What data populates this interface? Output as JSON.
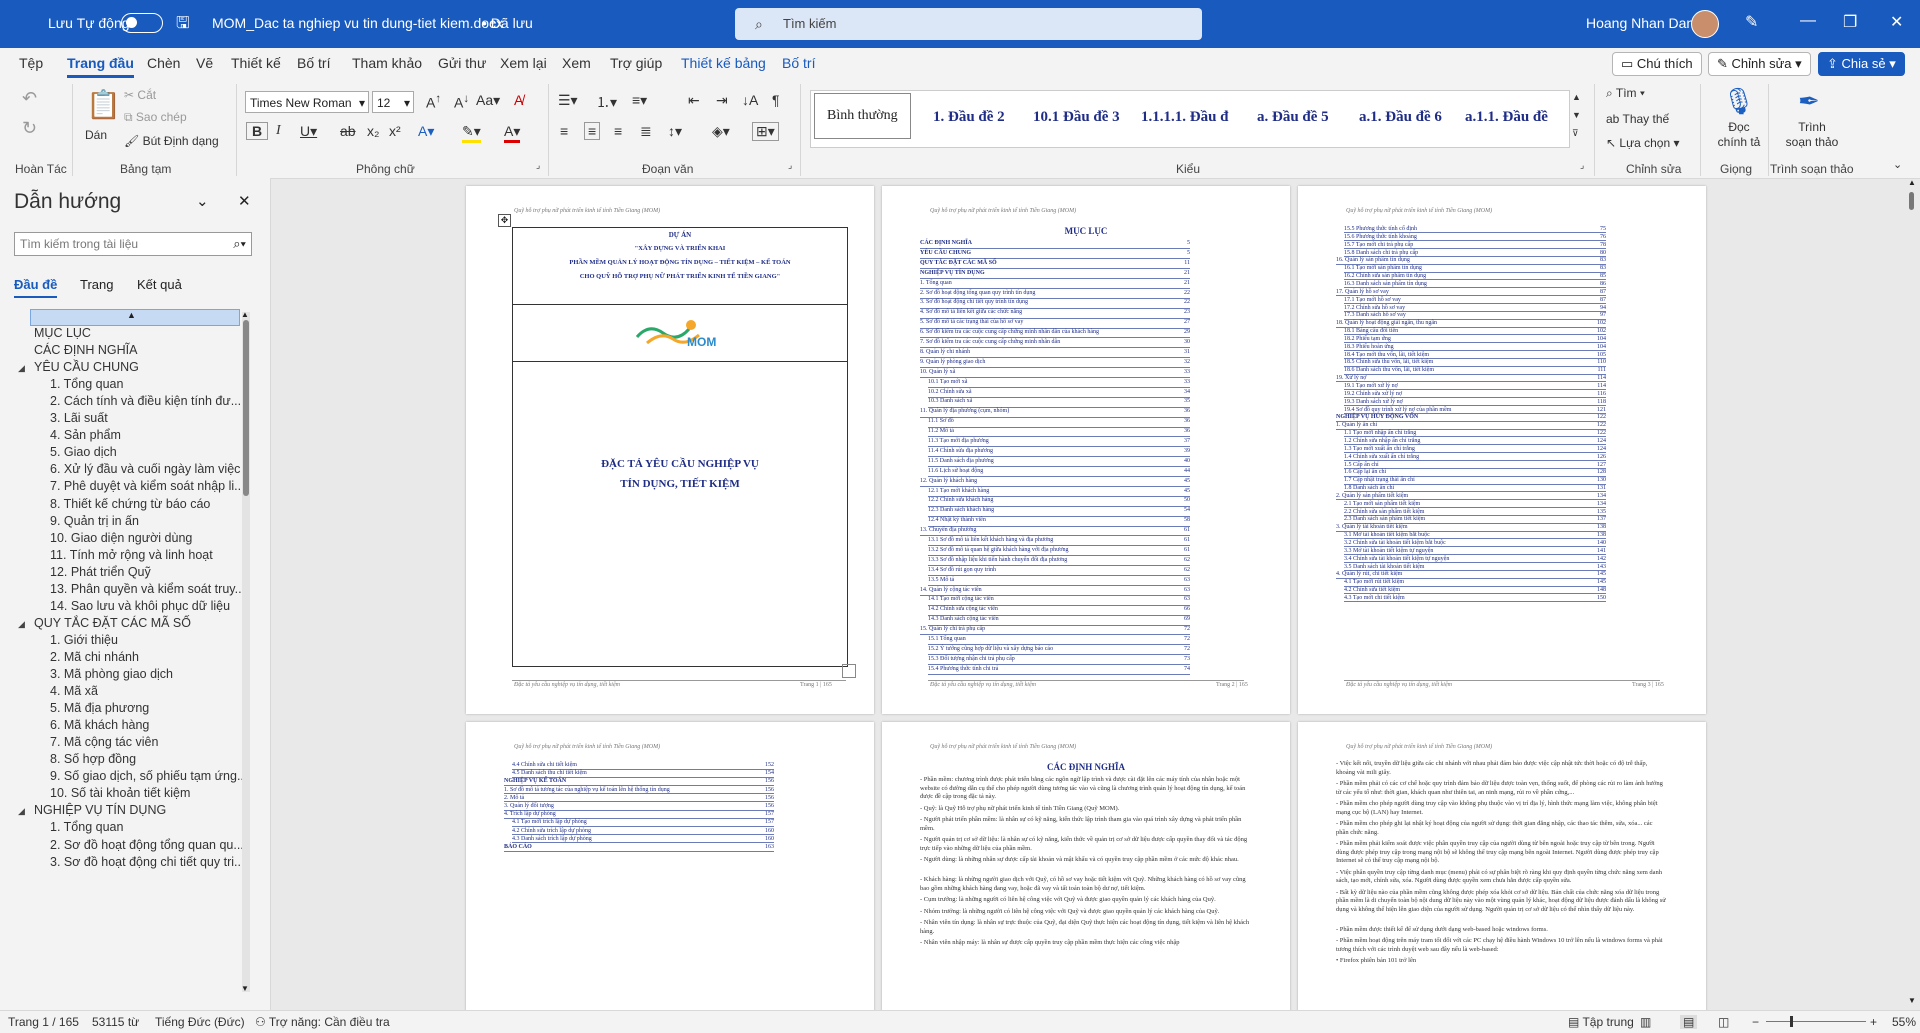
{
  "titlebar": {
    "autosave_label": "Lưu Tự động",
    "doc_title": "MOM_Dac ta nghiep vu tin dung-tiet kiem.docx",
    "saved_status": "• Đã lưu",
    "search_placeholder": "Tìm kiếm",
    "user_name": "Hoang Nhan Dang"
  },
  "tabs": [
    "Tệp",
    "Trang đầu",
    "Chèn",
    "Vẽ",
    "Thiết kế",
    "Bố trí",
    "Tham khảo",
    "Gửi thư",
    "Xem lại",
    "Xem",
    "Trợ giúp",
    "Thiết kế bảng",
    "Bố trí"
  ],
  "tab_buttons": {
    "comments": "Chú thích",
    "editing": "Chỉnh sửa",
    "share": "Chia sẻ"
  },
  "ribbon": {
    "undo_group": "Hoàn Tác",
    "clipboard": {
      "paste": "Dán",
      "cut": "Cắt",
      "copy": "Sao chép",
      "format_painter": "Bút Định dạng",
      "group": "Bảng tạm"
    },
    "font": {
      "name": "Times New Roman",
      "size": "12",
      "group": "Phông chữ"
    },
    "paragraph_group": "Đoạn văn",
    "styles": [
      "Bình thường",
      "1.  Đầu đề 2",
      "10.1  Đầu đề 3",
      "1.1.1.1.  Đầu đ",
      "a.  Đầu đề 5",
      "a.1.  Đầu đề 6",
      "a.1.1.  Đầu đề"
    ],
    "styles_group": "Kiểu",
    "editing": {
      "find": "Tìm",
      "replace": "Thay thế",
      "select": "Lựa chọn",
      "group": "Chỉnh sửa"
    },
    "voice": {
      "dictate": "Đọc chính tả",
      "group": "Giọng"
    },
    "editor": {
      "label": "Trình soạn thảo",
      "group": "Trình soạn thảo"
    }
  },
  "nav": {
    "title": "Dẫn hướng",
    "search_placeholder": "Tìm kiếm trong tài liệu",
    "tabs": [
      "Đầu đề",
      "Trang",
      "Kết quả"
    ],
    "items": [
      {
        "text": "MỤC LỤC",
        "level": 0
      },
      {
        "text": "CÁC ĐỊNH NGHĨA",
        "level": 0
      },
      {
        "text": "YÊU CẦU CHUNG",
        "level": 0,
        "expanded": true
      },
      {
        "text": "1. Tổng quan",
        "level": 1
      },
      {
        "text": "2. Cách tính và điều kiện tính đư...",
        "level": 1
      },
      {
        "text": "3. Lãi suất",
        "level": 1
      },
      {
        "text": "4. Sản phẩm",
        "level": 1
      },
      {
        "text": "5. Giao dịch",
        "level": 1
      },
      {
        "text": "6. Xử lý đầu và cuối ngày làm việc",
        "level": 1
      },
      {
        "text": "7. Phê duyệt và kiểm soát nhập li...",
        "level": 1
      },
      {
        "text": "8. Thiết kế chứng từ báo cáo",
        "level": 1
      },
      {
        "text": "9. Quản trị in ấn",
        "level": 1
      },
      {
        "text": "10. Giao diện người dùng",
        "level": 1
      },
      {
        "text": "11. Tính mở rộng và linh hoạt",
        "level": 1
      },
      {
        "text": "12. Phát triển Quỹ",
        "level": 1
      },
      {
        "text": "13. Phân quyền và kiểm soát truy...",
        "level": 1
      },
      {
        "text": "14. Sao lưu và khôi phục dữ liệu",
        "level": 1
      },
      {
        "text": "QUY TẮC ĐẶT CÁC MÃ SỐ",
        "level": 0,
        "expanded": true
      },
      {
        "text": "1. Giới thiệu",
        "level": 1
      },
      {
        "text": "2. Mã chi nhánh",
        "level": 1
      },
      {
        "text": "3. Mã phòng giao dịch",
        "level": 1
      },
      {
        "text": "4. Mã xã",
        "level": 1
      },
      {
        "text": "5. Mã địa phương",
        "level": 1
      },
      {
        "text": "6. Mã khách hàng",
        "level": 1
      },
      {
        "text": "7. Mã cộng tác viên",
        "level": 1
      },
      {
        "text": "8. Số hợp đồng",
        "level": 1
      },
      {
        "text": "9. Số giao dịch, số phiếu tạm ứng...",
        "level": 1
      },
      {
        "text": "10. Số tài khoản tiết kiệm",
        "level": 1
      },
      {
        "text": "NGHIỆP VỤ TÍN DỤNG",
        "level": 0,
        "expanded": true
      },
      {
        "text": "1. Tổng quan",
        "level": 1
      },
      {
        "text": "2. Sơ đồ hoạt động tổng quan qu...",
        "level": 1
      },
      {
        "text": "3. Sơ đồ hoạt động chi tiết quy tri...",
        "level": 1
      }
    ]
  },
  "pages": {
    "header_text": "Quỹ hỗ trợ phụ nữ phát triển kinh tế tỉnh Tiền Giang (MOM)",
    "footer_text": "Đặc tả yêu cầu nghiệp vụ tín dụng, tiết kiệm",
    "page1": {
      "project": "DỰ ÁN",
      "line1": "\"XÂY DỰNG VÀ TRIỂN KHAI",
      "line2": "PHẦN MỀM QUẢN LÝ HOẠT ĐỘNG TÍN DỤNG – TIẾT KIỆM – KẾ TOÁN",
      "line3": "CHO QUỸ HỖ TRỢ PHỤ NỮ PHÁT TRIỂN KINH TẾ TIỀN GIANG\"",
      "logo_text": "MOM",
      "title1": "ĐẶC TẢ YÊU CẦU NGHIỆP VỤ",
      "title2": "TÍN DỤNG, TIẾT KIỆM",
      "page_num": "Trang 1 | 165"
    },
    "page2": {
      "title": "MỤC LỤC",
      "page_num": "Trang 2 | 165",
      "entries": [
        [
          "CÁC ĐỊNH NGHĨA",
          "5"
        ],
        [
          "YÊU CẦU CHUNG",
          "5"
        ],
        [
          "QUY TẮC ĐẶT CÁC MÃ SỐ",
          "11"
        ],
        [
          "NGHIỆP VỤ TÍN DỤNG",
          "21"
        ],
        [
          "1. Tổng quan",
          "21"
        ],
        [
          "2. Sơ đồ hoạt động tổng quan quy trình tín dụng",
          "22"
        ],
        [
          "3. Sơ đồ hoạt động chi tiết quy trình tín dụng",
          "22"
        ],
        [
          "4. Sơ đồ mô tả liên kết giữa các chức năng",
          "23"
        ],
        [
          "5. Sơ đồ mô tả các trạng thái của hồ sơ vay",
          "27"
        ],
        [
          "6. Sơ đồ kiểm tra các cuộc cung cấp chứng minh nhân dân của khách hàng",
          "29"
        ],
        [
          "7. Sơ đồ kiểm tra các cuộc cung cấp chứng minh nhân dân",
          "30"
        ],
        [
          "8. Quản lý chi nhánh",
          "31"
        ],
        [
          "9. Quản lý phòng giao dịch",
          "32"
        ],
        [
          "10. Quản lý xã",
          "33"
        ],
        [
          "10.1 Tạo mới xã",
          "33"
        ],
        [
          "10.2 Chỉnh sửa xã",
          "34"
        ],
        [
          "10.3 Danh sách xã",
          "35"
        ],
        [
          "11. Quản lý địa phương (cụm, nhóm)",
          "36"
        ],
        [
          "11.1 Sơ đồ",
          "36"
        ],
        [
          "11.2 Mô tả",
          "36"
        ],
        [
          "11.3 Tạo mới địa phương",
          "37"
        ],
        [
          "11.4 Chỉnh sửa địa phương",
          "39"
        ],
        [
          "11.5 Danh sách địa phương",
          "40"
        ],
        [
          "11.6 Lịch sử hoạt động",
          "44"
        ],
        [
          "12. Quản lý khách hàng",
          "45"
        ],
        [
          "12.1 Tạo mới khách hàng",
          "45"
        ],
        [
          "12.2 Chỉnh sửa khách hàng",
          "50"
        ],
        [
          "12.3 Danh sách khách hàng",
          "54"
        ],
        [
          "12.4 Nhật ký thành viên",
          "58"
        ],
        [
          "13. Chuyển địa phương",
          "61"
        ],
        [
          "13.1 Sơ đồ mô tả liên kết khách hàng và địa phương",
          "61"
        ],
        [
          "13.2 Sơ đồ mô tả quan hệ giữa khách hàng với địa phương",
          "61"
        ],
        [
          "13.3 Sơ đồ nhập liệu khi tiến hành chuyển đổi địa phương",
          "62"
        ],
        [
          "13.4 Sơ đồ rút gọn quy trình",
          "62"
        ],
        [
          "13.5 Mô tả",
          "63"
        ],
        [
          "14. Quản lý cộng tác viên",
          "63"
        ],
        [
          "14.1 Tạo mới cộng tác viên",
          "63"
        ],
        [
          "14.2 Chỉnh sửa cộng tác viên",
          "66"
        ],
        [
          "14.3 Danh sách cộng tác viên",
          "69"
        ],
        [
          "15. Quản lý chi trả phụ cấp",
          "72"
        ],
        [
          "15.1 Tổng quan",
          "72"
        ],
        [
          "15.2 Ý tưởng cũng hợp dữ liệu và xây dựng báo cáo",
          "72"
        ],
        [
          "15.3 Đối tượng nhận chi trả phụ cấp",
          "73"
        ],
        [
          "15.4 Phương thức tính chi trả",
          "74"
        ]
      ]
    },
    "page3": {
      "page_num": "Trang 3 | 165",
      "entries": [
        [
          "15.5 Phương thức tính cố định",
          "75"
        ],
        [
          "15.6 Phương thức tính khoảng",
          "76"
        ],
        [
          "15.7 Tạo mới chi trả phụ cấp",
          "78"
        ],
        [
          "15.8 Danh sách chi trả phụ cấp",
          "80"
        ],
        [
          "16. Quản lý sản phẩm tín dụng",
          "83"
        ],
        [
          "16.1 Tạo mới sản phẩm tín dụng",
          "83"
        ],
        [
          "16.2 Chỉnh sửa sản phẩm tín dụng",
          "85"
        ],
        [
          "16.3 Danh sách sản phẩm tín dụng",
          "86"
        ],
        [
          "17. Quản lý hồ sơ vay",
          "87"
        ],
        [
          "17.1 Tạo mới hồ sơ vay",
          "87"
        ],
        [
          "17.2 Chỉnh sửa hồ sơ vay",
          "94"
        ],
        [
          "17.3 Danh sách hồ sơ vay",
          "97"
        ],
        [
          "18. Quản lý hoạt động giải ngân, thu ngân",
          "102"
        ],
        [
          "18.1 Bảng câu đối tiền",
          "102"
        ],
        [
          "18.2 Phiếu tạm ứng",
          "104"
        ],
        [
          "18.3 Phiếu hoàn ứng",
          "104"
        ],
        [
          "18.4 Tạo mới thu vốn, lãi, tiết kiệm",
          "105"
        ],
        [
          "18.5 Chỉnh sửa thu vốn, lãi, tiết kiệm",
          "110"
        ],
        [
          "18.6 Danh sách thu vốn, lãi, tiết kiệm",
          "111"
        ],
        [
          "19. Xử lý nợ",
          "114"
        ],
        [
          "19.1 Tạo mới xử lý nợ",
          "114"
        ],
        [
          "19.2 Chỉnh sửa xử lý nợ",
          "116"
        ],
        [
          "19.3 Danh sách xử lý nợ",
          "118"
        ],
        [
          "19.4 Sơ đồ quy trình xử lý nợ của phần mềm",
          "121"
        ],
        [
          "NGHIỆP VỤ HUY ĐỘNG VỐN",
          "122"
        ],
        [
          "1. Quản lý ấn chỉ",
          "122"
        ],
        [
          "1.1 Tạo mới nhập ấn chỉ trắng",
          "122"
        ],
        [
          "1.2 Chỉnh sửa nhập ấn chỉ trắng",
          "124"
        ],
        [
          "1.3 Tạo mới xuất ấn chỉ trắng",
          "124"
        ],
        [
          "1.4 Chỉnh sửa xuất ấn chỉ trắng",
          "126"
        ],
        [
          "1.5 Cấp ấn chỉ",
          "127"
        ],
        [
          "1.6 Cập lại ấn chỉ",
          "128"
        ],
        [
          "1.7 Cập nhật trạng thái ấn chỉ",
          "130"
        ],
        [
          "1.8 Danh sách ấn chỉ",
          "131"
        ],
        [
          "2. Quản lý sản phẩm tiết kiệm",
          "134"
        ],
        [
          "2.1 Tạo mới sản phẩm tiết kiệm",
          "134"
        ],
        [
          "2.2 Chỉnh sửa sản phẩm tiết kiệm",
          "135"
        ],
        [
          "2.3 Danh sách sản phẩm tiết kiệm",
          "137"
        ],
        [
          "3. Quản lý tài khoản tiết kiệm",
          "138"
        ],
        [
          "3.1 Mở tài khoản tiết kiệm bắt buộc",
          "138"
        ],
        [
          "3.2 Chỉnh sửa tài khoản tiết kiệm bắt buộc",
          "140"
        ],
        [
          "3.3 Mở tài khoản tiết kiệm tự nguyện",
          "141"
        ],
        [
          "3.4 Chỉnh sửa tài khoản tiết kiệm tự nguyện",
          "142"
        ],
        [
          "3.5 Danh sách tài khoản tiết kiệm",
          "143"
        ],
        [
          "4. Quản lý rút, chi tiết kiệm",
          "145"
        ],
        [
          "4.1 Tạo mới rút tiết kiệm",
          "145"
        ],
        [
          "4.2 Chỉnh sửa tiết kiệm",
          "148"
        ],
        [
          "4.3 Tạo mới chi tiết kiệm",
          "150"
        ]
      ]
    },
    "page4": {
      "entries": [
        [
          "4.4 Chỉnh sửa chi tiết kiệm",
          "152"
        ],
        [
          "4.5 Danh sách thu chi tiết kiệm",
          "154"
        ],
        [
          "NGHIỆP VỤ KẾ TOÁN",
          "156"
        ],
        [
          "1. Sơ đồ mô tả tương tác của nghiệp vụ kế toán lên hệ thống tín dụng",
          "156"
        ],
        [
          "2. Mô tả",
          "156"
        ],
        [
          "3. Quản lý đối tượng",
          "156"
        ],
        [
          "4. Trích lập dự phòng",
          "157"
        ],
        [
          "4.1 Tạo mới trích lập dự phòng",
          "157"
        ],
        [
          "4.2 Chỉnh sửa trích lập dự phòng",
          "160"
        ],
        [
          "4.3 Danh sách trích lập dự phòng",
          "160"
        ],
        [
          "BÁO CÁO",
          "163"
        ]
      ]
    },
    "page5": {
      "title": "CÁC ĐỊNH NGHĨA",
      "paras": [
        "- Phần mềm: chương trình được phát triển bằng các ngôn ngữ lập trình và được cài đặt lên các máy tính của nhân hoặc một website có đường dẫn cụ thể cho phép người dùng tương tác vào và cũng là chương trình quản lý hoạt động tín dụng, kế toán được đề cập trong đặc tả này.",
        "- Quỹ: là Quỹ Hỗ trợ phụ nữ phát triển kinh tế tỉnh Tiền Giang (Quỹ MOM).",
        "- Người phát triển phần mềm: là nhân sự có kỹ năng, kiến thức lập trình tham gia vào quá trình xây dựng và phát triển phần mềm.",
        "- Người quản trị cơ sở dữ liệu: là nhân sự có kỹ năng, kiến thức về quản trị cơ sở dữ liệu được cấp quyền thay đổi và tác động trực tiếp vào những dữ liệu của phần mềm.",
        "- Người dùng: là những nhân sự được cấp tài khoản và mật khẩu và có quyền truy cập phần mềm ở các mức độ khác nhau.",
        "- Khách hàng: là những người giao dịch với Quỹ, có hồ sơ vay hoặc tiết kiệm với Quỹ. Những khách hàng có hồ sơ vay cũng bao gồm những khách hàng đang vay, hoặc đã vay và tất toán toàn bộ dư nợ, tiết kiệm.",
        "- Cụm trưởng: là những người có liên hệ công việc với Quỹ và được giao quyền quản lý các khách hàng của Quỹ.",
        "- Nhóm trưởng: là những người có liên hệ công việc với Quỹ và được giao quyền quản lý các khách hàng của Quỹ.",
        "- Nhân viên tín dụng: là nhân sự trực thuộc của Quỹ, đại diện Quỹ thực hiện các hoạt động tín dụng, tiết kiệm và liên hệ khách hàng.",
        "- Nhân viên nhập máy: là nhân sự được cấp quyền truy cập phần mềm thực hiện các công việc nhập"
      ]
    },
    "page6": {
      "paras": [
        "- Việc kết nối, truyền dữ liệu giữa các chi nhánh với nhau phải đảm bảo được việc cập nhật tức thời hoặc có độ trễ thấp, khoảng vài mili giây.",
        "- Phần mềm phải có các cơ chế hoặc quy trình đảm bảo dữ liệu được toàn vẹn, thống suốt, để phòng các rủi ro làm ảnh hưởng từ các yếu tố như: thời gian, khách quan như thiên tai, an ninh mạng, rủi ro về phần cứng,...",
        "- Phần mềm cho phép người dùng truy cập vào không phụ thuộc vào vị trí địa lý, hình thức mạng làm việc, không phân biệt mạng cục bộ (LAN) hay Internet.",
        "- Phần mềm cho phép ghi lại nhật ký hoạt động của người sử dụng: thời gian đăng nhập, các thao tác thêm, sửa, xóa... các phần chức năng.",
        "- Phần mềm phải kiểm soát được việc phân quyền truy cập của người dùng từ bên ngoài hoặc truy cập từ bên trong. Người dùng được phép truy cập trong mạng nội bộ sẽ không thể truy cập mạng bên ngoài Internet. Người dùng được phép truy cập Internet sẽ có thể truy cập mạng nội bộ.",
        "- Việc phân quyền truy cập từng danh mục (menu) phải có sự phân biệt rõ ràng khi quy định quyền từng chức năng xem danh sách, tạo mới, chỉnh sửa, xóa. Người dùng được quyền xem chưa hẳn được cấp quyền sửa.",
        "- Bất kỳ dữ liệu nào của phần mềm cũng không được phép xóa khỏi cơ sở dữ liệu. Bản chất của chức năng xóa dữ liệu trong phần mềm là di chuyển toàn bộ nội dung dữ liệu này vào một vùng quản lý khác, hoạt động dữ liệu được đánh dấu là không sử dụng và không thể hiện lên giao diện của người sử dụng. Người quản trị cơ sở dữ liệu có thể nhìn thấy dữ liệu này.",
        "- Phần mềm được thiết kế để sử dụng dưới dạng web-based hoặc windows forms.",
        "- Phần mềm hoạt động trên máy tram tối đối với các PC chạy hệ điều hành Windows 10 trở lên nếu là windows forms và phải tương thích với các trình duyệt web sau đây nếu là web-based:",
        "• Firefox phiên bản 101 trở lên"
      ]
    }
  },
  "status": {
    "page": "Trang 1 / 165",
    "words": "53115 từ",
    "language": "Tiếng Đức (Đức)",
    "accessibility": "Trợ năng: Cần điều tra",
    "focus": "Tập trung",
    "zoom": "55%"
  }
}
